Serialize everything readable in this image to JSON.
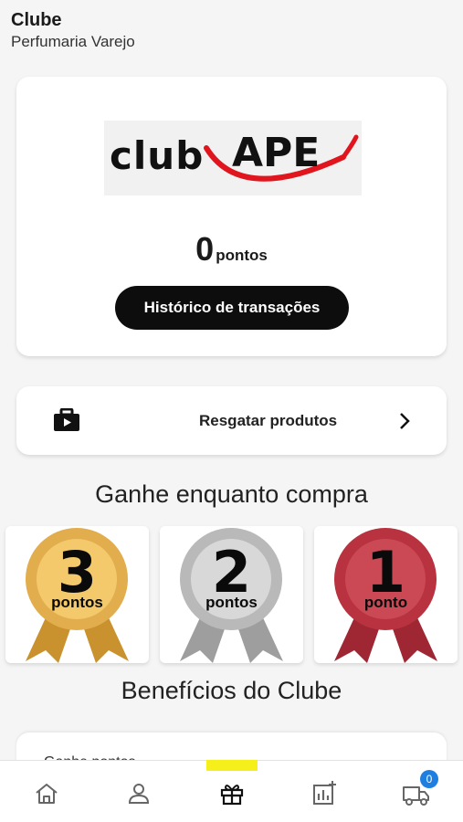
{
  "header": {
    "title": "Clube",
    "subtitle": "Perfumaria Varejo"
  },
  "club_card": {
    "logo_text_club": "club",
    "logo_text_ape": "APE",
    "points_value": "0",
    "points_unit": "pontos",
    "history_button": "Histórico de transações"
  },
  "redeem": {
    "label": "Resgatar produtos",
    "icon": "briefcase-icon"
  },
  "earn_section": {
    "title": "Ganhe enquanto compra",
    "medals": [
      {
        "number": "3",
        "unit": "pontos",
        "color": "#d9a441"
      },
      {
        "number": "2",
        "unit": "pontos",
        "color": "#bdbdbd"
      },
      {
        "number": "1",
        "unit": "ponto",
        "color": "#b8323f"
      }
    ]
  },
  "benefits_section": {
    "title": "Benefícios do Clube",
    "first_item": "Ganhe pontos"
  },
  "bottom_nav": {
    "items": [
      "home-icon",
      "profile-icon",
      "gift-icon",
      "reports-icon",
      "delivery-icon"
    ],
    "active_index": 2,
    "cart_badge": "0",
    "active_color": "#f5ef1b"
  }
}
